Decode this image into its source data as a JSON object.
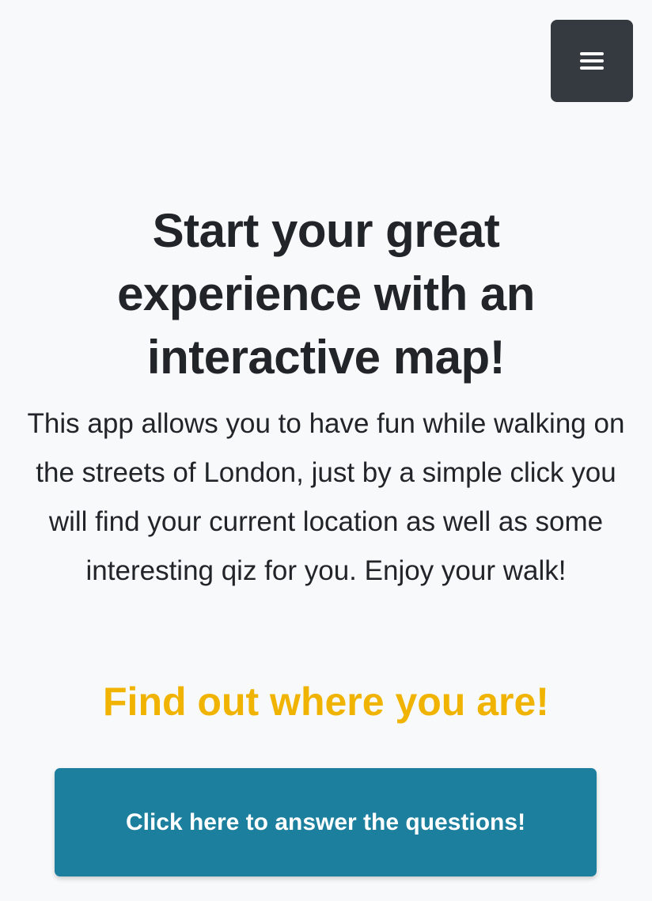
{
  "navbar": {
    "menu_icon": "hamburger-icon",
    "background_color": "#343a40"
  },
  "hero": {
    "title": "Start your great experience with an interactive map!",
    "description": "This app allows you to have fun while walking on the streets of London, just by a simple click you will find your current location as well as some interesting qiz for you. Enjoy your walk!"
  },
  "location": {
    "heading": "Find out where you are!",
    "heading_color": "#f0b400"
  },
  "quiz": {
    "button_label": "Click here to answer the questions!",
    "button_color": "#1b7f9d"
  }
}
